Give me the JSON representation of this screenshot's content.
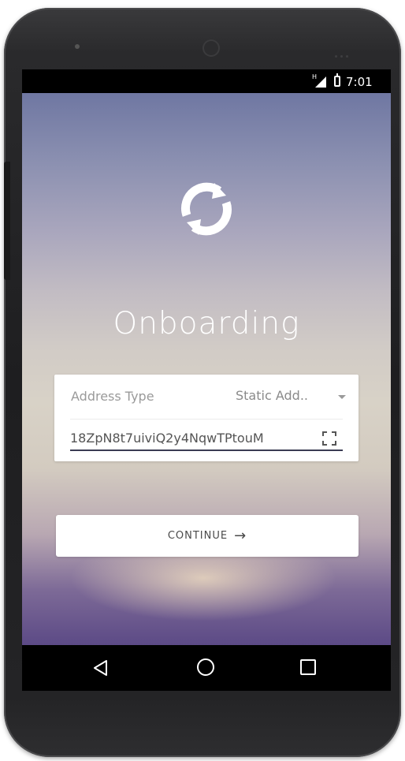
{
  "status_bar": {
    "network_label": "H",
    "time": "7:01"
  },
  "app": {
    "title": "Onboarding",
    "logo_icon": "sync-refresh-icon",
    "address_type": {
      "label": "Address Type",
      "selected_value": "Static Add..",
      "options": [
        "Static Add.."
      ]
    },
    "address_input": {
      "value": "18ZpN8t7uiviQ2y4NqwTPtouM",
      "scan_icon": "qr-scan-icon"
    },
    "continue_button": {
      "label": "CONTINUE",
      "arrow": "→"
    }
  },
  "nav_bar": {
    "back_icon": "back-triangle-icon",
    "home_icon": "home-circle-icon",
    "recent_icon": "recent-apps-square-icon"
  },
  "colors": {
    "underline": "#3a3b53",
    "background_top": "#6f77a2",
    "background_bottom": "#5c4a86"
  }
}
